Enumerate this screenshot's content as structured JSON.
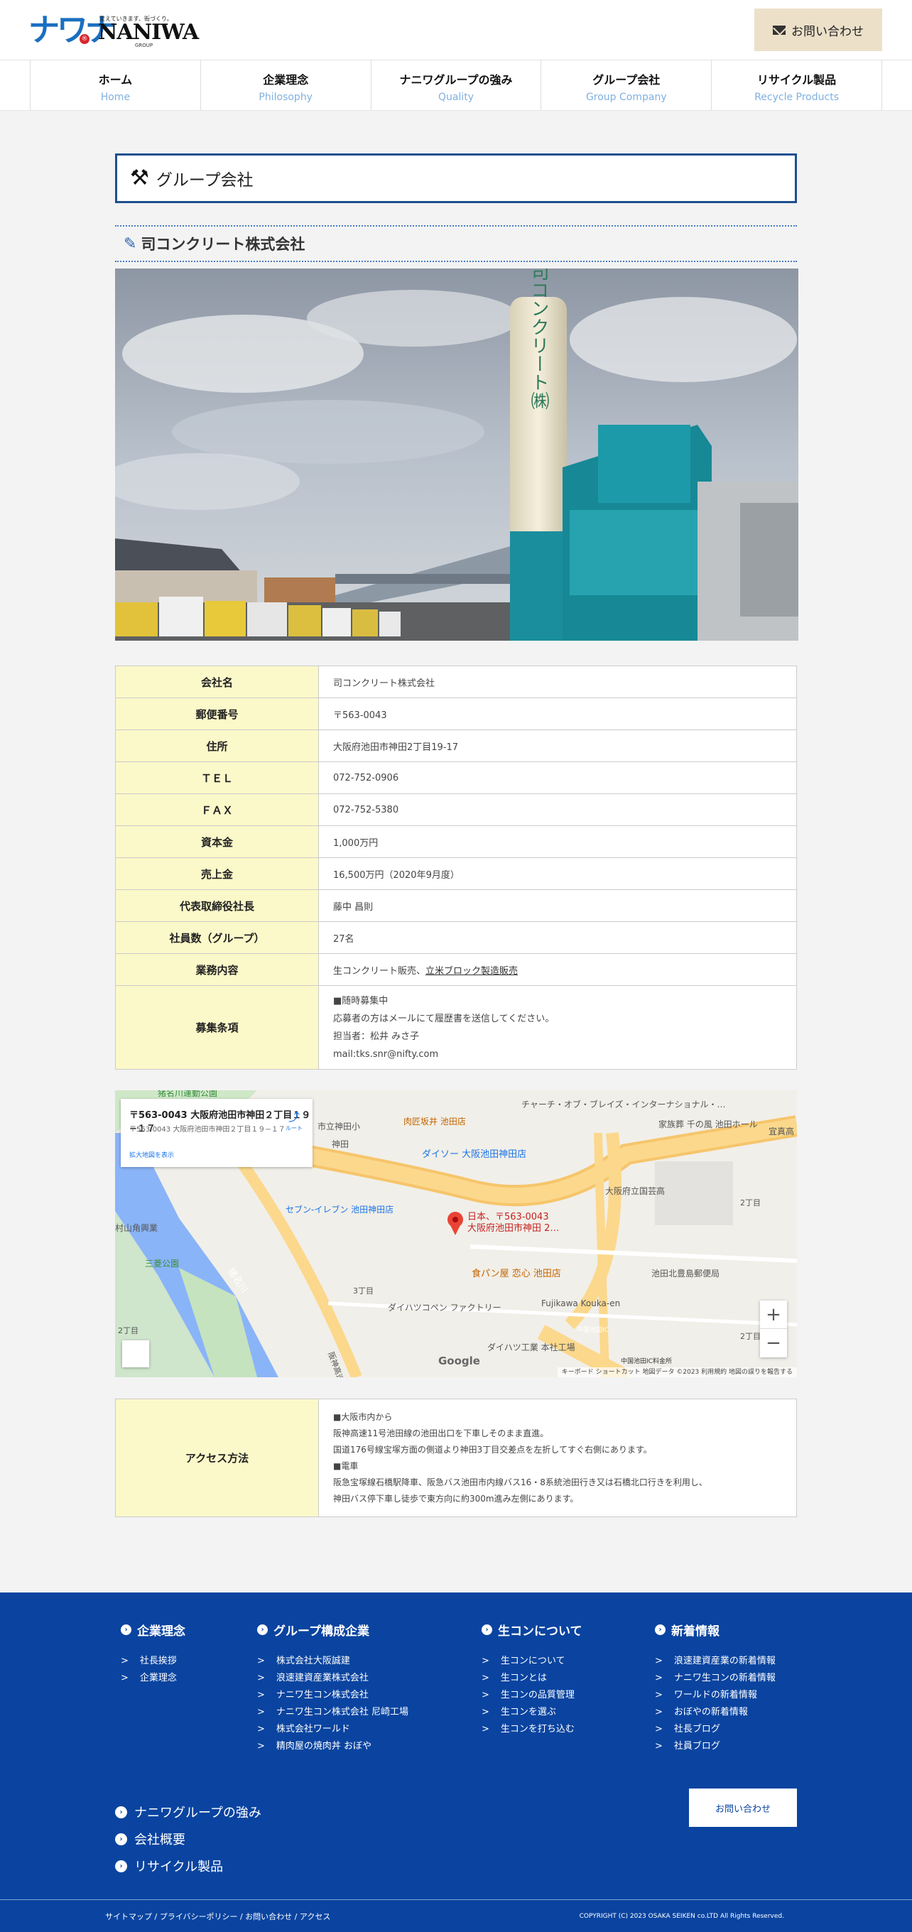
{
  "header": {
    "logo_mark": "ナワナ",
    "logo_tagline": "変えていきます、街づくり。",
    "logo_name": "NANIWA",
    "logo_group": "GROUP",
    "contact_label": "お問い合わせ"
  },
  "nav": [
    {
      "jp": "ホーム",
      "en": "Home"
    },
    {
      "jp": "企業理念",
      "en": "Philosophy"
    },
    {
      "jp": "ナニワグループの強み",
      "en": "Quality"
    },
    {
      "jp": "グループ会社",
      "en": "Group Company"
    },
    {
      "jp": "リサイクル製品",
      "en": "Recycle Products"
    }
  ],
  "page_title": "グループ会社",
  "section_title": "司コンクリート株式会社",
  "photo": {
    "silo_text": "司コンクリート㈱"
  },
  "company": [
    {
      "label": "会社名",
      "value": "司コンクリート株式会社"
    },
    {
      "label": "郵便番号",
      "value": "〒563-0043"
    },
    {
      "label": "住所",
      "value": "大阪府池田市神田2丁目19-17"
    },
    {
      "label": "ＴＥＬ",
      "value": "072-752-0906"
    },
    {
      "label": "ＦＡＸ",
      "value": "072-752-5380"
    },
    {
      "label": "資本金",
      "value": "1,000万円"
    },
    {
      "label": "売上金",
      "value": "16,500万円（2020年9月度）"
    },
    {
      "label": "代表取締役社長",
      "value": "藤中 昌則"
    },
    {
      "label": "社員数（グループ）",
      "value": "27名"
    },
    {
      "label": "業務内容",
      "value": "生コンクリート販売、",
      "link": "立米ブロック製造販売"
    },
    {
      "label": "募集条項",
      "lines": [
        "■随時募集中",
        "応募者の方はメールにて履歴書を送信してください。",
        "担当者：松井 みさ子",
        "mail:tks.snr@nifty.com"
      ]
    }
  ],
  "map": {
    "card_title": "〒563-0043 大阪府池田市神田２丁目１９−１７",
    "card_address": "〒563-0043 大阪府池田市神田２丁目１９−１７",
    "card_link": "拡大地図を表示",
    "route_label": "ルート",
    "pin_label_1": "日本、〒563-0043",
    "pin_label_2": "大阪府池田市神田 2…",
    "google": "Google",
    "copyright": "キーボード ショートカット  地図データ ©2023  利用規約  地図の誤りを報告する",
    "zoom_in": "+",
    "zoom_out": "−",
    "places": [
      "猪名川運動公園",
      "チャーチ・オブ・ブレイズ・インターナショナル・…",
      "肉匠坂井 池田店",
      "市立神田小",
      "家族葬 千の風 池田ホール",
      "宜真高",
      "ダイソー 大阪池田神田店",
      "神田",
      "大阪府立国芸高",
      "2丁目",
      "セブン-イレブン 池田神田店",
      "村山角興業",
      "三菱公園",
      "猪名川",
      "食パン屋 恋心 池田店",
      "池田北豊島郵便局",
      "3丁目",
      "ダイハツコペン ファクトリー",
      "Fujikawa Kouka-en",
      "中国池田IC",
      "2丁目",
      "ダイハツ工業 本社工場",
      "中国池田IC料金所",
      "2丁目",
      "阪神高速"
    ]
  },
  "access": {
    "label": "アクセス方法",
    "lines": [
      "■大阪市内から",
      "阪神高速11号池田線の池田出口を下車しそのまま直進。",
      "国道176号線宝塚方面の側道より神田3丁目交差点を左折してすぐ右側にあります。",
      "■電車",
      "阪急宝塚線石橋駅降車、阪急バス池田市内線バス16・8系統池田行き又は石橋北口行きを利用し、",
      "神田バス停下車し徒歩で東方向に約300m進み左側にあります。"
    ]
  },
  "footer": {
    "columns": [
      {
        "title": "企業理念",
        "items": [
          "社長挨拶",
          "企業理念"
        ]
      },
      {
        "title": "グループ構成企業",
        "items": [
          "株式会社大阪誠建",
          "浪速建資産業株式会社",
          "ナニワ生コン株式会社",
          "ナニワ生コン株式会社 尼崎工場",
          "株式会社ワールド",
          "精肉屋の焼肉丼 おぼや"
        ]
      },
      {
        "title": "生コンについて",
        "items": [
          "生コンについて",
          "生コンとは",
          "生コンの品質管理",
          "生コンを選ぶ",
          "生コンを打ち込む"
        ]
      },
      {
        "title": "新着情報",
        "items": [
          "浪速建資産業の新着情報",
          "ナニワ生コンの新着情報",
          "ワールドの新着情報",
          "おぼやの新着情報",
          "社長ブログ",
          "社員ブログ"
        ]
      }
    ],
    "big_links": [
      "ナニワグループの強み",
      "会社概要",
      "リサイクル製品"
    ],
    "contact_label": "お問い合わせ",
    "bottom_links": [
      "サイトマップ",
      "プライバシーポリシー",
      "お問い合わせ",
      "アクセス"
    ],
    "copyright": "COPYRIGHT (C) 2023 OSAKA SEIKEN co.LTD All Rights Reserved."
  },
  "colors": {
    "accent": "#0a44a0",
    "title_border": "#1e4f8f",
    "label_bg": "#fbf8c9",
    "contact_bg": "#ece0c9"
  }
}
